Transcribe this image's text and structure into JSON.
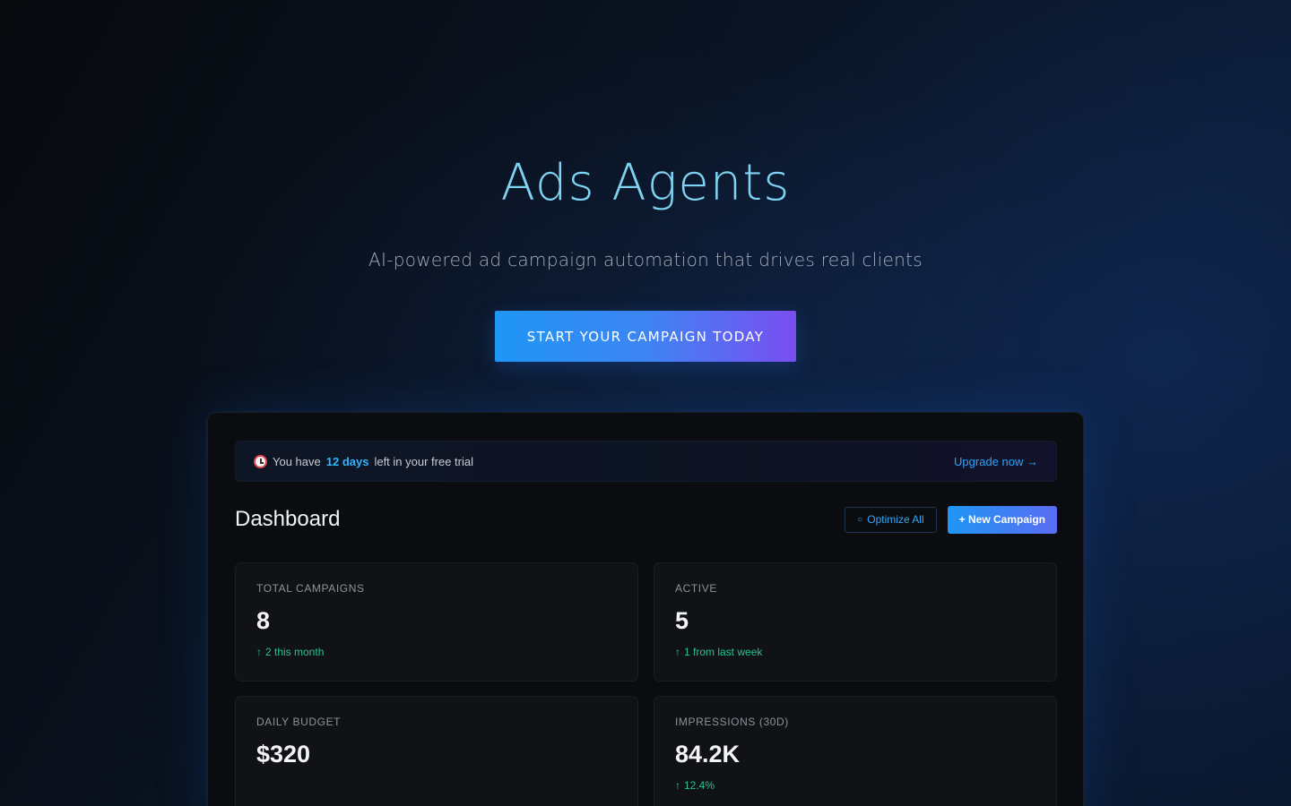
{
  "hero": {
    "title": "Ads Agents",
    "subtitle": "AI-powered ad campaign automation that drives real clients",
    "cta_label": "START YOUR CAMPAIGN TODAY"
  },
  "trial_banner": {
    "prefix": "You have",
    "days": "12 days",
    "suffix": "left in your free trial",
    "upgrade_label": "Upgrade now →"
  },
  "dashboard": {
    "title": "Dashboard",
    "optimize_label": "Optimize All",
    "new_campaign_label": "+ New Campaign"
  },
  "stats": [
    {
      "label": "TOTAL CAMPAIGNS",
      "value": "8",
      "delta": "2 this month"
    },
    {
      "label": "ACTIVE",
      "value": "5",
      "delta": "1 from last week"
    },
    {
      "label": "DAILY BUDGET",
      "value": "$320",
      "delta": ""
    },
    {
      "label": "IMPRESSIONS (30D)",
      "value": "84.2K",
      "delta": "12.4%"
    }
  ],
  "colors": {
    "accent_blue": "#1f96f5",
    "accent_purple": "#7a4ef1",
    "positive_green": "#22c58b",
    "title_cyan": "#7fd3f2"
  },
  "icons": {
    "trial": "alarm-clock-icon",
    "optimize": "circle-icon",
    "delta": "arrow-up-icon"
  }
}
